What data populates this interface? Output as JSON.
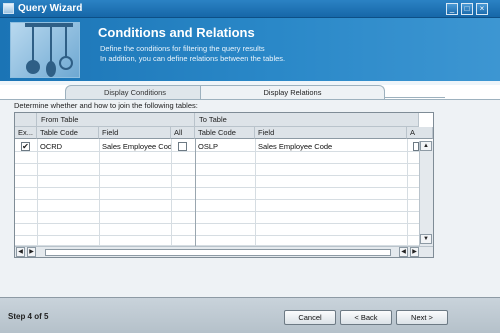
{
  "window": {
    "title": "Query Wizard"
  },
  "window_controls": [
    {
      "name": "minimize-button",
      "glyph": "_",
      "icon": "minimize-icon"
    },
    {
      "name": "maximize-button",
      "glyph": "□",
      "icon": "maximize-icon"
    },
    {
      "name": "close-button",
      "glyph": "×",
      "icon": "close-icon"
    }
  ],
  "header": {
    "title": "Conditions and Relations",
    "line1": "Define the conditions for filtering the query results",
    "line2": "In addition, you can define relations between the tables.",
    "image_icon": "kitchen-utensils-icon"
  },
  "tabs": [
    {
      "label": "Display Conditions",
      "active": false
    },
    {
      "label": "Display Relations",
      "active": true
    }
  ],
  "instruction": "Determine whether and how to join the following tables:",
  "grid": {
    "group_from": "From Table",
    "group_to": "To Table",
    "columns": {
      "ex": "Ex...",
      "from_table_code": "Table Code",
      "from_field": "Field",
      "all": "All",
      "to_table_code": "Table Code",
      "to_field": "Field",
      "a": "A"
    },
    "rows": [
      {
        "ex_checked": true,
        "from_table_code": "OCRD",
        "from_field": "Sales Employee Code",
        "all_checked": false,
        "to_table_code": "OSLP",
        "to_field": "Sales Employee Code",
        "a_checked": false
      }
    ],
    "empty_rows": 8
  },
  "scroll_glyphs": {
    "up": "▲",
    "down": "▼",
    "left": "◀",
    "right": "▶"
  },
  "footer": {
    "step": "Step 4 of 5",
    "cancel": "Cancel",
    "back": "< Back",
    "next": "Next >"
  },
  "colors": {
    "title_bar": "#1b6fb0",
    "header": "#2a88c8",
    "panel": "#eef2f5",
    "footer": "#bfc9d1"
  }
}
